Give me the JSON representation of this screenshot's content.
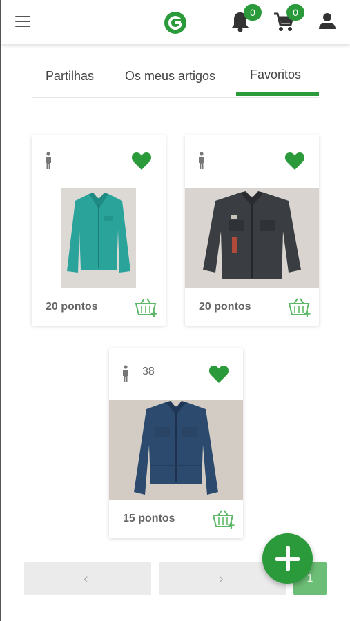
{
  "header": {
    "menu_icon": "hamburger-menu-icon",
    "logo_icon": "green-circle-logo-icon",
    "notifications_count": "0",
    "cart_count": "0",
    "user_icon": "user-account-icon",
    "accent_color": "#2b9a3a"
  },
  "tabs": [
    {
      "label": "Partilhas",
      "active": false
    },
    {
      "label": "Os meus artigos",
      "active": false
    },
    {
      "label": "Favoritos",
      "active": true
    }
  ],
  "items": [
    {
      "size": "",
      "points": "20 pontos",
      "favorited": true,
      "photo": "teal jacket"
    },
    {
      "size": "",
      "points": "20 pontos",
      "favorited": true,
      "photo": "dark denim jacket with patches"
    },
    {
      "size": "38",
      "points": "15 pontos",
      "favorited": true,
      "photo": "blue denim jacket"
    }
  ],
  "pagination": {
    "prev_icon": "chevron-left-icon",
    "next_icon": "chevron-right-icon",
    "current_page": "1",
    "prev_symbol": "‹",
    "next_symbol": "›"
  },
  "fab_icon": "plus-icon"
}
